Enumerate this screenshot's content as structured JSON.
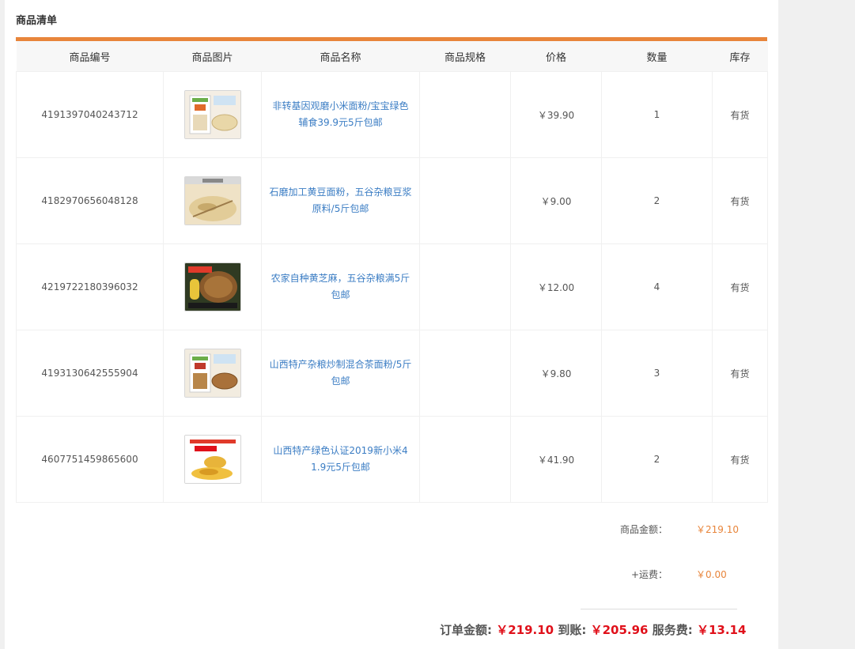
{
  "section_title": "商品清单",
  "columns": [
    "商品编号",
    "商品图片",
    "商品名称",
    "商品规格",
    "价格",
    "数量",
    "库存"
  ],
  "rows": [
    {
      "id": "4191397040243712",
      "name": "非转基因观磨小米面粉/宝宝绿色辅食39.9元5斤包邮",
      "spec": "",
      "price": "￥39.90",
      "qty": "1",
      "stock": "有货",
      "thumb": "millet-flour-bag"
    },
    {
      "id": "4182970656048128",
      "name": "石磨加工黄豆面粉，五谷杂粮豆浆原料/5斤包邮",
      "spec": "",
      "price": "￥9.00",
      "qty": "2",
      "stock": "有货",
      "thumb": "soybean-flour"
    },
    {
      "id": "4219722180396032",
      "name": "农家自种黄芝麻，五谷杂粮满5斤包邮",
      "spec": "",
      "price": "￥12.00",
      "qty": "4",
      "stock": "有货",
      "thumb": "sesame-seeds"
    },
    {
      "id": "4193130642555904",
      "name": "山西特产杂粮炒制混合茶面粉/5斤包邮",
      "spec": "",
      "price": "￥9.80",
      "qty": "3",
      "stock": "有货",
      "thumb": "mixed-tea-flour-bag"
    },
    {
      "id": "4607751459865600",
      "name": "山西特产绿色认证2019新小米41.9元5斤包邮",
      "spec": "",
      "price": "￥41.90",
      "qty": "2",
      "stock": "有货",
      "thumb": "millet-grain"
    }
  ],
  "summary": {
    "goods_amount_label": "商品金额：",
    "goods_amount_value": "￥219.10",
    "shipping_label": "+运费：",
    "shipping_value": "￥0.00"
  },
  "final": {
    "order_label": "订单金额:",
    "order_value": "￥219.10",
    "received_label": "到账:",
    "received_value": "￥205.96",
    "fee_label": "服务费:",
    "fee_value": "￥13.14"
  },
  "colors": {
    "accent_orange": "#e8853b",
    "link_blue": "#3b7dc4",
    "total_red": "#e0101a"
  }
}
